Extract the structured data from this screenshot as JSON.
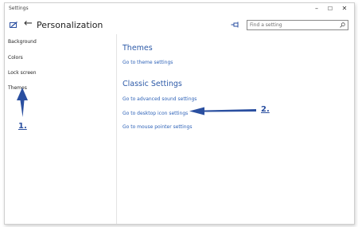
{
  "window": {
    "title": "Settings",
    "controls": {
      "minimize": "–",
      "maximize": "☐",
      "close": "✕"
    }
  },
  "header": {
    "back": "←",
    "title": "Personalization"
  },
  "search": {
    "placeholder": "Find a setting"
  },
  "sidebar": {
    "items": [
      {
        "label": "Background"
      },
      {
        "label": "Colors"
      },
      {
        "label": "Lock screen"
      },
      {
        "label": "Themes"
      }
    ]
  },
  "main": {
    "themes_title": "Themes",
    "theme_settings_link": "Go to theme settings",
    "classic_title": "Classic Settings",
    "classic_links": [
      {
        "label": "Go to advanced sound settings"
      },
      {
        "label": "Go to desktop icon settings"
      },
      {
        "label": "Go to mouse pointer settings"
      }
    ]
  },
  "annotations": {
    "step1": "1.",
    "step2": "2."
  },
  "colors": {
    "accent": "#2d5aa8",
    "link": "#2f63b8",
    "annotation": "#2a4fa0"
  }
}
